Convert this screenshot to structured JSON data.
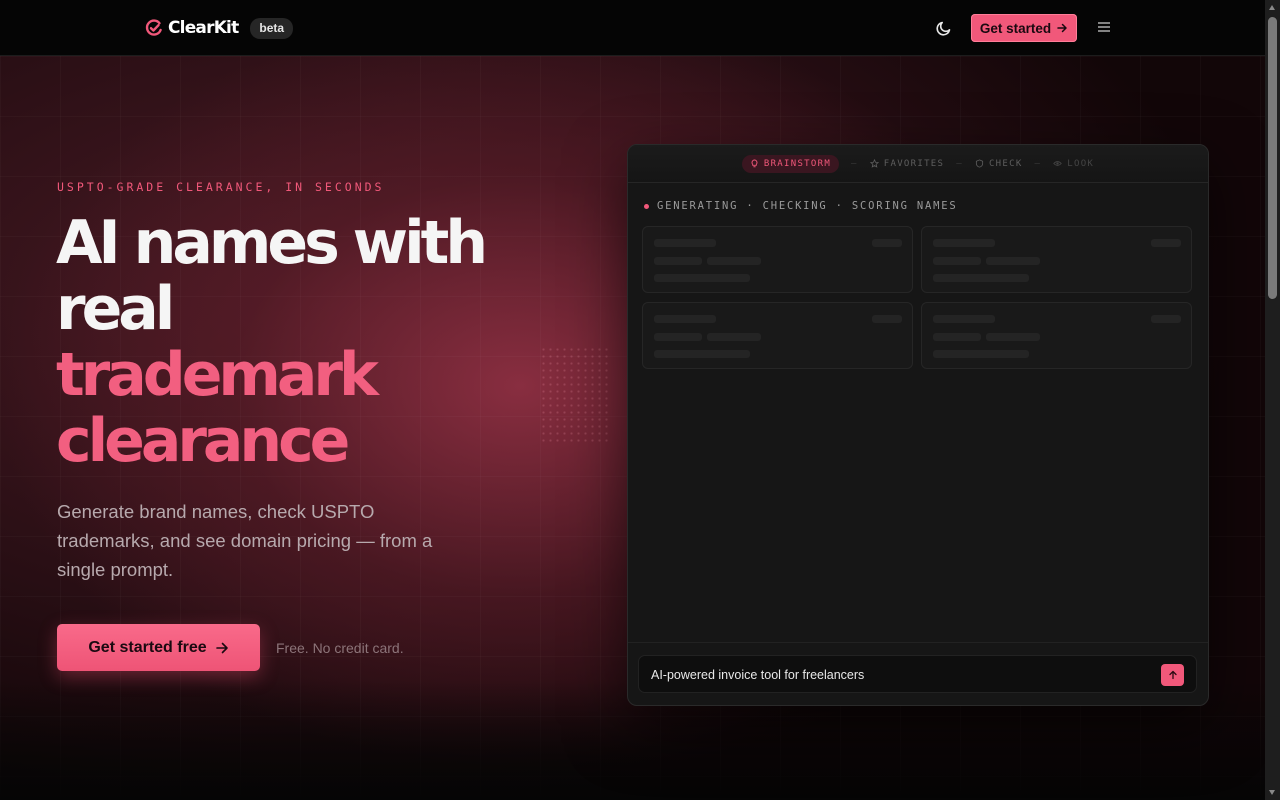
{
  "nav": {
    "brand": "ClearKit",
    "badge": "beta",
    "theme_toggle_icon": "moon-icon",
    "cta_label": "Get started",
    "cta_icon": "arrow-right-icon",
    "menu_icon": "hamburger-menu-icon"
  },
  "hero": {
    "eyebrow": "USPTO-GRADE CLEARANCE, IN SECONDS",
    "headline_line1": "AI names with",
    "headline_line2": "real",
    "headline_line3": "trademark",
    "headline_line4": "clearance",
    "subheadline": "Generate brand names, check USPTO trademarks, and see domain pricing — from a single prompt.",
    "cta_label": "Get started free",
    "cta_note": "Free. No credit card."
  },
  "app": {
    "tabs": [
      {
        "label": "BRAINSTORM",
        "icon": "lightbulb-icon",
        "active": true
      },
      {
        "label": "FAVORITES",
        "icon": "star-icon",
        "active": false
      },
      {
        "label": "CHECK",
        "icon": "shield-icon",
        "active": false
      },
      {
        "label": "LOOK",
        "icon": "eye-icon",
        "active": false
      }
    ],
    "tab_separator": "—",
    "status": "GENERATING · CHECKING · SCORING NAMES",
    "prompt_value": "AI-powered invoice tool for freelancers",
    "send_icon": "arrow-up-icon"
  },
  "colors": {
    "accent": "#f1587a",
    "background": "#050505",
    "panel": "#161616"
  }
}
